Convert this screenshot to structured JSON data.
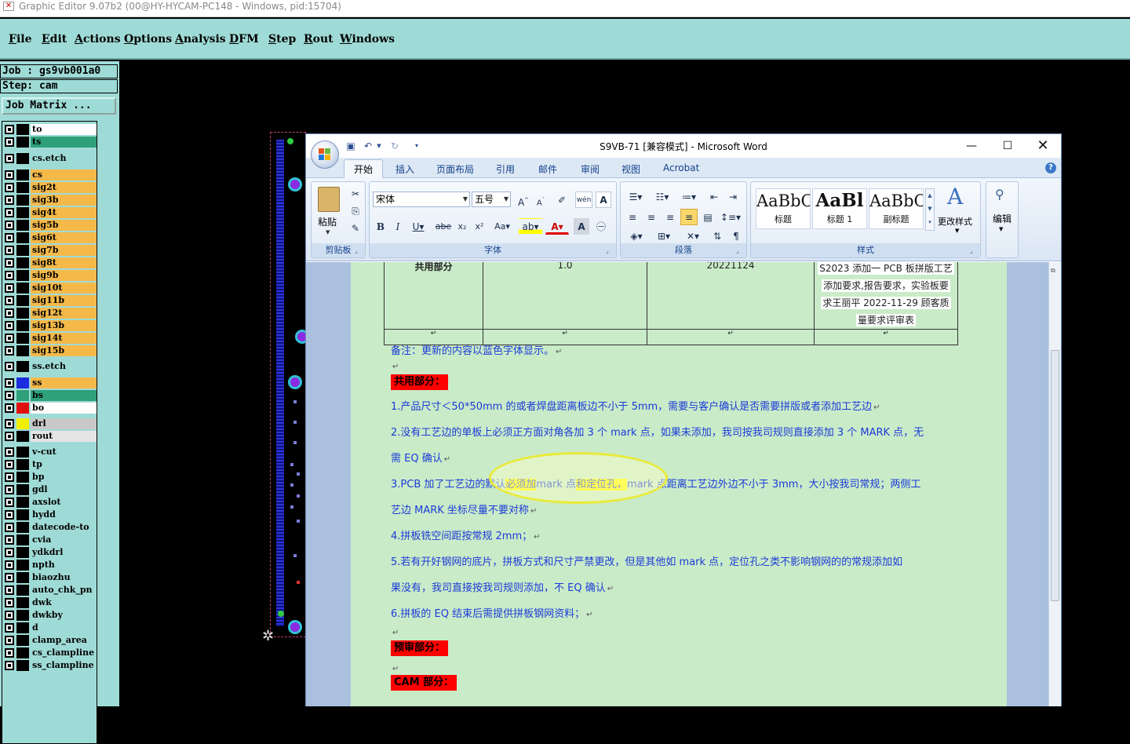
{
  "app": {
    "title": "Graphic Editor 9.07b2 (00@HY-HYCAM-PC148 - Windows, pid:15704)",
    "menus": [
      "File",
      "Edit",
      "Actions",
      "Options",
      "Analysis",
      "DFM",
      "Step",
      "Rout",
      "Windows"
    ],
    "job_label": "Job : gs9vb001a0",
    "step_label": "Step: cam",
    "job_matrix": "Job Matrix ..."
  },
  "layers": [
    {
      "name": "to",
      "color": "#ffffff",
      "swatch": "#000000"
    },
    {
      "name": "ts",
      "color": "#2ea07a",
      "swatch": "#000000"
    },
    {
      "name": "cs.etch",
      "color": "#9fdbd6",
      "swatch": "#000000"
    },
    {
      "name": "cs",
      "color": "#f5b94a",
      "swatch": "#000000"
    },
    {
      "name": "sig2t",
      "color": "#f5b94a",
      "swatch": "#000000"
    },
    {
      "name": "sig3b",
      "color": "#f5b94a",
      "swatch": "#000000"
    },
    {
      "name": "sig4t",
      "color": "#f5b94a",
      "swatch": "#000000"
    },
    {
      "name": "sig5b",
      "color": "#f5b94a",
      "swatch": "#000000"
    },
    {
      "name": "sig6t",
      "color": "#f5b94a",
      "swatch": "#000000"
    },
    {
      "name": "sig7b",
      "color": "#f5b94a",
      "swatch": "#000000"
    },
    {
      "name": "sig8t",
      "color": "#f5b94a",
      "swatch": "#000000"
    },
    {
      "name": "sig9b",
      "color": "#f5b94a",
      "swatch": "#000000"
    },
    {
      "name": "sig10t",
      "color": "#f5b94a",
      "swatch": "#000000"
    },
    {
      "name": "sig11b",
      "color": "#f5b94a",
      "swatch": "#000000"
    },
    {
      "name": "sig12t",
      "color": "#f5b94a",
      "swatch": "#000000"
    },
    {
      "name": "sig13b",
      "color": "#f5b94a",
      "swatch": "#000000"
    },
    {
      "name": "sig14t",
      "color": "#f5b94a",
      "swatch": "#000000"
    },
    {
      "name": "sig15b",
      "color": "#f5b94a",
      "swatch": "#000000"
    },
    {
      "name": "ss.etch",
      "color": "#9fdbd6",
      "swatch": "#000000"
    },
    {
      "name": "ss",
      "color": "#f5b94a",
      "swatch": "#1b2be0"
    },
    {
      "name": "bs",
      "color": "#2ea07a",
      "swatch": "#2ea07a"
    },
    {
      "name": "bo",
      "color": "#ffffff",
      "swatch": "#e01010"
    },
    {
      "name": "drl",
      "color": "#c8c8c8",
      "swatch": "#f0f000"
    },
    {
      "name": "rout",
      "color": "#e4e4e4",
      "swatch": "#000000"
    },
    {
      "name": "v-cut",
      "color": "#9fdbd6",
      "swatch": "#000000"
    },
    {
      "name": "tp",
      "color": "#9fdbd6",
      "swatch": "#000000"
    },
    {
      "name": "bp",
      "color": "#9fdbd6",
      "swatch": "#000000"
    },
    {
      "name": "gdl",
      "color": "#9fdbd6",
      "swatch": "#000000"
    },
    {
      "name": "axslot",
      "color": "#9fdbd6",
      "swatch": "#000000"
    },
    {
      "name": "hydd",
      "color": "#9fdbd6",
      "swatch": "#000000"
    },
    {
      "name": "datecode-to",
      "color": "#9fdbd6",
      "swatch": "#000000"
    },
    {
      "name": "cvia",
      "color": "#9fdbd6",
      "swatch": "#000000"
    },
    {
      "name": "ydkdrl",
      "color": "#9fdbd6",
      "swatch": "#000000"
    },
    {
      "name": "npth",
      "color": "#9fdbd6",
      "swatch": "#000000"
    },
    {
      "name": "biaozhu",
      "color": "#9fdbd6",
      "swatch": "#000000"
    },
    {
      "name": "auto_chk_pn",
      "color": "#9fdbd6",
      "swatch": "#000000"
    },
    {
      "name": "dwk",
      "color": "#9fdbd6",
      "swatch": "#000000"
    },
    {
      "name": "dwkby",
      "color": "#9fdbd6",
      "swatch": "#000000"
    },
    {
      "name": "d",
      "color": "#9fdbd6",
      "swatch": "#000000"
    },
    {
      "name": "clamp_area",
      "color": "#9fdbd6",
      "swatch": "#000000"
    },
    {
      "name": "cs_clampline",
      "color": "#9fdbd6",
      "swatch": "#000000"
    },
    {
      "name": "ss_clampline",
      "color": "#9fdbd6",
      "swatch": "#000000"
    }
  ],
  "word": {
    "title": "S9VB-71 [兼容模式] - Microsoft Word",
    "tabs": [
      "开始",
      "插入",
      "页面布局",
      "引用",
      "邮件",
      "审阅",
      "视图",
      "Acrobat"
    ],
    "clipboard": {
      "paste": "粘贴",
      "label": "剪贴板"
    },
    "font": {
      "name": "宋体",
      "size": "五号",
      "label": "字体"
    },
    "paragraph": {
      "label": "段落"
    },
    "styles": {
      "items": [
        {
          "sample": "AaBbC",
          "name": "标题"
        },
        {
          "sample": "AaBl",
          "name": "标题 1"
        },
        {
          "sample": "AaBbC",
          "name": "副标题"
        }
      ],
      "change": "更改样式",
      "label": "样式"
    },
    "edit": {
      "label": "编辑"
    }
  },
  "doc": {
    "table_row1": [
      "共用部分",
      "1.0",
      "20221124",
      ""
    ],
    "revision_lines": [
      "S2023 添加一 PCB 板拼版工艺",
      "添加要求,报告要求，实验板要",
      "求王丽平 2022-11-29 顾客质",
      "量要求评审表"
    ],
    "note": "备注：更新的内容以蓝色字体显示。",
    "sec_common": "共用部分：",
    "p1": "1.产品尺寸＜50*50mm 的或者焊盘距离板边不小于 5mm，需要与客户确认是否需要拼版或者添加工艺边",
    "p2a": "2.没有工艺边的单板上必须正方面对角各加 3 个 mark 点，如果未添加，我司按我司规则直接添加 3 个 MARK 点，无",
    "p2b": "需 EQ 确认",
    "p3_pre": "3.PCB 加了工艺边的默认",
    "p3_hl1": "必须加",
    "p3_mid": "mark 点",
    "p3_hl2": "和定位孔，",
    "p3_post": "mark 点距离工艺边外边不小于 3mm，大小按我司常规；两侧工",
    "p3b": "艺边 MARK 坐标尽量不要对称",
    "p4": "4.拼板铣空间距按常规 2mm；",
    "p5a": "5.若有开好钢网的底片，拼板方式和尺寸严禁更改，但是其他如 mark 点，定位孔之类不影响钢网的的常规添加如",
    "p5b": "果没有，我司直接按我司规则添加，不 EQ 确认",
    "p6": "6.拼板的 EQ 结束后需提供拼板钢网资料；",
    "sec_review": "预审部分：",
    "sec_cam": "CAM 部分："
  }
}
